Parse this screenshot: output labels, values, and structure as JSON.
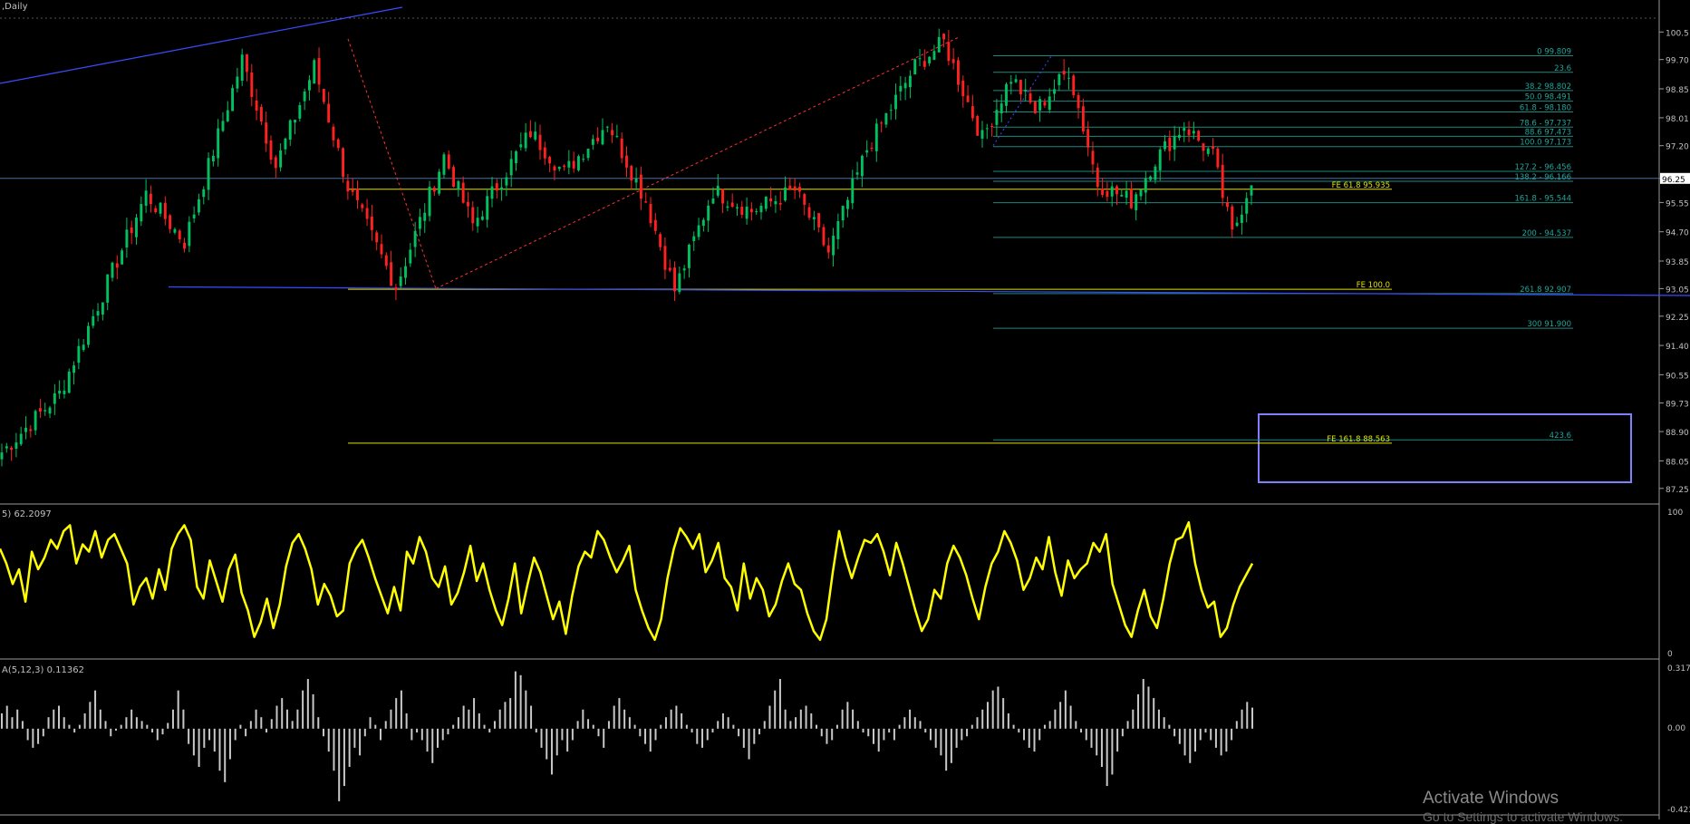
{
  "colors": {
    "background": "#000000",
    "bull": "#00c060",
    "bear": "#ff2020",
    "fibo": "#1a8a80",
    "fibo_text": "#1fa59a",
    "fe": "#e0e000",
    "trend": "#3a4cff",
    "osc": "#ffff00",
    "hist": "#c8c8c8",
    "axis_text": "#c0c0c0",
    "current_price_line": "#4a6fa0",
    "highlight_box": "#8080ff"
  },
  "chart_data": [
    {
      "type": "candlestick",
      "title": ",Daily",
      "ylim": [
        86.85,
        100.85
      ],
      "price_axis_ticks": [
        "100.5",
        "99.70",
        "98.85",
        "98.01",
        "97.20",
        "96.25",
        "95.55",
        "94.70",
        "93.85",
        "93.05",
        "92.25",
        "91.40",
        "90.55",
        "89.73",
        "88.90",
        "88.05",
        "87.25"
      ],
      "current_price": 96.25,
      "current_price_label": "96.25",
      "pivots": [
        {
          "bar": 0,
          "price": 88.3
        },
        {
          "bar": 12,
          "price": 90.0
        },
        {
          "bar": 30,
          "price": 95.8
        },
        {
          "bar": 38,
          "price": 94.4
        },
        {
          "bar": 50,
          "price": 99.7
        },
        {
          "bar": 57,
          "price": 96.6
        },
        {
          "bar": 65,
          "price": 99.5
        },
        {
          "bar": 72,
          "price": 96.0
        },
        {
          "bar": 82,
          "price": 93.1
        },
        {
          "bar": 92,
          "price": 96.9
        },
        {
          "bar": 98,
          "price": 94.9
        },
        {
          "bar": 110,
          "price": 97.6
        },
        {
          "bar": 117,
          "price": 96.4
        },
        {
          "bar": 126,
          "price": 97.9
        },
        {
          "bar": 134,
          "price": 95.6
        },
        {
          "bar": 140,
          "price": 93.0
        },
        {
          "bar": 148,
          "price": 95.9
        },
        {
          "bar": 156,
          "price": 95.3
        },
        {
          "bar": 165,
          "price": 95.9
        },
        {
          "bar": 172,
          "price": 94.1
        },
        {
          "bar": 180,
          "price": 97.1
        },
        {
          "bar": 190,
          "price": 99.5
        },
        {
          "bar": 196,
          "price": 100.2
        },
        {
          "bar": 204,
          "price": 97.4
        },
        {
          "bar": 210,
          "price": 99.2
        },
        {
          "bar": 215,
          "price": 98.2
        },
        {
          "bar": 222,
          "price": 99.4
        },
        {
          "bar": 228,
          "price": 96.1
        },
        {
          "bar": 235,
          "price": 95.6
        },
        {
          "bar": 240,
          "price": 96.8
        },
        {
          "bar": 246,
          "price": 97.8
        },
        {
          "bar": 252,
          "price": 96.9
        },
        {
          "bar": 256,
          "price": 94.6
        },
        {
          "bar": 260,
          "price": 96.25
        }
      ],
      "fibo_levels": [
        {
          "label": "0 99.809",
          "price": 99.809
        },
        {
          "label": "23.6",
          "price": 99.33
        },
        {
          "label": "38.2 98.802",
          "price": 98.802
        },
        {
          "label": "50.0 98.491",
          "price": 98.491
        },
        {
          "label": "61.8 - 98.180",
          "price": 98.18
        },
        {
          "label": "78.6 - 97.737",
          "price": 97.737
        },
        {
          "label": "88.6 97.473",
          "price": 97.473
        },
        {
          "label": "100.0 97.173",
          "price": 97.173
        },
        {
          "label": "127.2 - 96.456",
          "price": 96.456
        },
        {
          "label": "138.2 - 96.166",
          "price": 96.166
        },
        {
          "label": "161.8 - 95.544",
          "price": 95.544
        },
        {
          "label": "200 - 94.537",
          "price": 94.537
        },
        {
          "label": "261.8 92.907",
          "price": 92.907
        },
        {
          "label": "300 91.900",
          "price": 91.9
        },
        {
          "label": "423.6",
          "price": 88.66
        }
      ],
      "fe_levels": [
        {
          "label": "FE 61.8 95.935",
          "price": 95.935
        },
        {
          "label": "FE 100.0",
          "price": 93.03
        },
        {
          "label": "FE 161.8 88.563",
          "price": 88.563
        }
      ]
    },
    {
      "type": "line",
      "title": "5) 62.2097",
      "ylim": [
        0,
        100
      ],
      "axis_ticks": [
        "100",
        "0"
      ],
      "values": [
        72,
        62,
        48,
        58,
        36,
        70,
        58,
        66,
        78,
        72,
        84,
        88,
        62,
        75,
        70,
        84,
        66,
        78,
        82,
        72,
        62,
        34,
        46,
        52,
        38,
        58,
        44,
        72,
        82,
        88,
        78,
        46,
        38,
        64,
        50,
        36,
        58,
        68,
        42,
        30,
        12,
        22,
        38,
        18,
        34,
        60,
        76,
        82,
        72,
        58,
        34,
        48,
        40,
        26,
        30,
        62,
        72,
        78,
        66,
        52,
        40,
        28,
        46,
        30,
        70,
        62,
        80,
        70,
        52,
        46,
        60,
        34,
        42,
        56,
        74,
        50,
        62,
        44,
        30,
        20,
        38,
        62,
        28,
        48,
        66,
        56,
        40,
        24,
        36,
        14,
        40,
        60,
        70,
        66,
        84,
        78,
        66,
        56,
        64,
        74,
        44,
        30,
        18,
        10,
        24,
        52,
        72,
        86,
        80,
        72,
        82,
        56,
        64,
        76,
        52,
        46,
        30,
        62,
        38,
        52,
        44,
        26,
        34,
        50,
        62,
        48,
        44,
        28,
        16,
        10,
        24,
        56,
        84,
        66,
        52,
        66,
        78,
        76,
        82,
        70,
        54,
        76,
        62,
        46,
        30,
        16,
        24,
        44,
        38,
        62,
        74,
        66,
        54,
        38,
        24,
        46,
        62,
        70,
        84,
        76,
        64,
        44,
        52,
        66,
        58,
        80,
        56,
        40,
        64,
        52,
        58,
        62,
        76,
        70,
        82,
        48,
        34,
        20,
        12,
        30,
        44,
        26,
        18,
        38,
        62,
        78,
        80,
        90,
        62,
        44,
        32,
        36,
        12,
        18,
        34,
        46,
        54,
        62
      ]
    },
    {
      "type": "bar",
      "title": "A(5,12,3) 0.11362",
      "ylim": [
        -0.423,
        0.317
      ],
      "axis_ticks": [
        "0.317",
        "0.00",
        "-0.423"
      ],
      "values": [
        0.08,
        0.12,
        0.06,
        0.1,
        0.04,
        -0.06,
        -0.1,
        -0.08,
        -0.04,
        0.06,
        0.1,
        0.12,
        0.06,
        0.02,
        -0.02,
        0.02,
        0.08,
        0.14,
        0.2,
        0.1,
        0.04,
        -0.04,
        -0.01,
        0.02,
        0.06,
        0.1,
        0.06,
        0.04,
        0.02,
        -0.02,
        -0.06,
        -0.03,
        0.03,
        0.1,
        0.2,
        0.1,
        -0.08,
        -0.14,
        -0.2,
        -0.1,
        -0.06,
        -0.12,
        -0.22,
        -0.28,
        -0.16,
        -0.06,
        0.02,
        -0.04,
        0.04,
        0.1,
        0.06,
        -0.02,
        0.05,
        0.12,
        0.16,
        0.1,
        0.04,
        0.1,
        0.2,
        0.26,
        0.18,
        0.06,
        -0.04,
        -0.12,
        -0.22,
        -0.38,
        -0.3,
        -0.2,
        -0.1,
        -0.14,
        -0.04,
        0.06,
        0.02,
        -0.06,
        0.04,
        0.1,
        0.16,
        0.2,
        0.08,
        -0.06,
        -0.02,
        -0.06,
        -0.12,
        -0.18,
        -0.1,
        -0.06,
        -0.03,
        0.02,
        0.06,
        0.12,
        0.1,
        0.16,
        0.08,
        0.02,
        -0.02,
        0.04,
        0.1,
        0.14,
        0.16,
        0.3,
        0.28,
        0.2,
        0.12,
        -0.02,
        -0.1,
        -0.16,
        -0.24,
        -0.14,
        -0.06,
        -0.12,
        -0.06,
        0.04,
        0.1,
        0.05,
        0.02,
        -0.04,
        -0.1,
        0.04,
        0.12,
        0.16,
        0.1,
        0.06,
        0.02,
        -0.04,
        -0.08,
        -0.12,
        -0.06,
        0.02,
        0.06,
        0.1,
        0.12,
        0.08,
        0.02,
        -0.02,
        -0.08,
        -0.1,
        -0.06,
        -0.02,
        0.04,
        0.08,
        0.06,
        0.02,
        -0.04,
        -0.1,
        -0.16,
        -0.08,
        -0.03,
        0.04,
        0.12,
        0.2,
        0.26,
        0.1,
        0.04,
        0.06,
        0.1,
        0.12,
        0.08,
        0.02,
        -0.04,
        -0.08,
        -0.06,
        0.02,
        0.1,
        0.14,
        0.1,
        0.04,
        -0.02,
        -0.04,
        -0.08,
        -0.12,
        -0.06,
        -0.02,
        -0.06,
        0.02,
        0.06,
        0.1,
        0.06,
        0.04,
        -0.02,
        -0.06,
        -0.1,
        -0.14,
        -0.22,
        -0.18,
        -0.1,
        -0.06,
        -0.04,
        0.02,
        0.06,
        0.1,
        0.14,
        0.2,
        0.22,
        0.16,
        0.08,
        0.02,
        -0.02,
        -0.06,
        -0.1,
        -0.12,
        -0.06,
        0.02,
        0.04,
        0.1,
        0.14,
        0.2,
        0.12,
        0.04,
        -0.02,
        -0.06,
        -0.1,
        -0.14,
        -0.2,
        -0.3,
        -0.24,
        -0.12,
        -0.04,
        0.04,
        0.1,
        0.18,
        0.26,
        0.22,
        0.16,
        0.1,
        0.06,
        0.02,
        -0.04,
        -0.08,
        -0.14,
        -0.18,
        -0.12,
        -0.06,
        -0.02,
        -0.06,
        -0.1,
        -0.14,
        -0.12,
        -0.06,
        0.04,
        0.1,
        0.14,
        0.11
      ]
    }
  ],
  "watermark": {
    "line1": "Activate Windows",
    "line2": "Go to Settings to activate Windows."
  }
}
